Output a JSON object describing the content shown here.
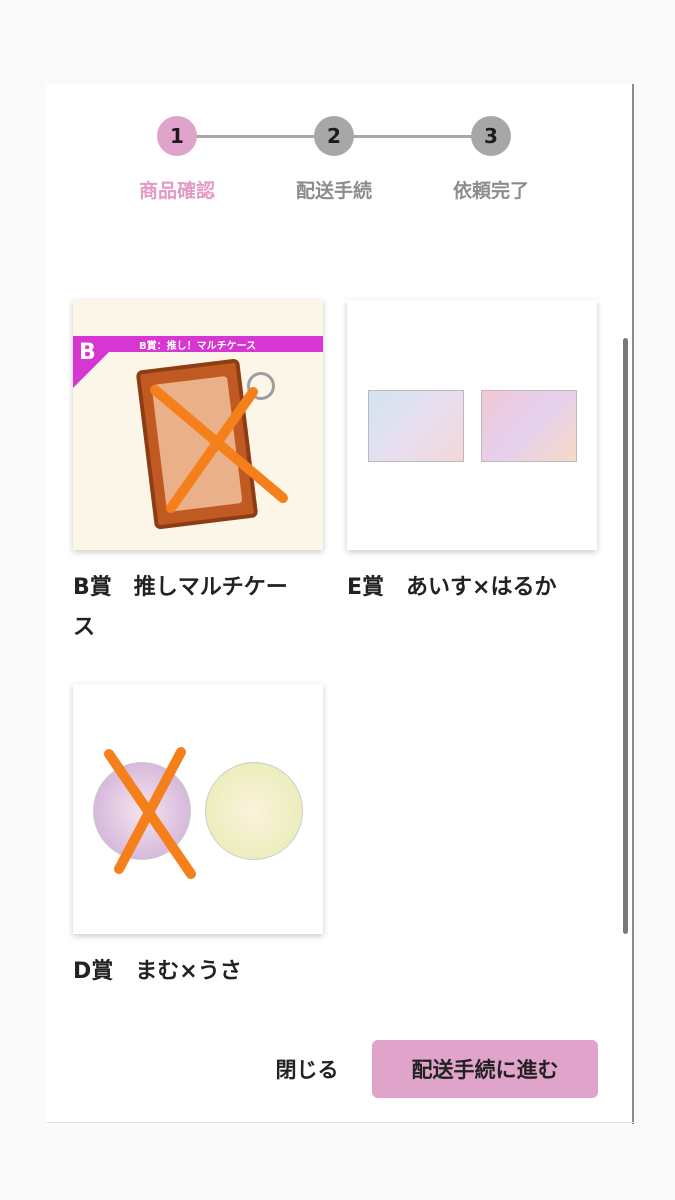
{
  "stepper": {
    "steps": [
      {
        "number": "1",
        "label": "商品確認",
        "state": "active"
      },
      {
        "number": "2",
        "label": "配送手続",
        "state": "inactive"
      },
      {
        "number": "3",
        "label": "依頼完了",
        "state": "inactive"
      }
    ]
  },
  "products": [
    {
      "title_line1": "B賞　推しマルチケー",
      "title_line2": "ス",
      "image_band_text": "B賞：推し！マルチケース",
      "image_badge": "B",
      "crossed_out": true
    },
    {
      "title_line1": "E賞　あいす×はるか",
      "crossed_out": false
    },
    {
      "title_line1": "D賞　まむ×うさ",
      "crossed_out": true
    }
  ],
  "footer": {
    "close_label": "閉じる",
    "next_label": "配送手続に進む"
  },
  "colors": {
    "accent": "#e0a3c9",
    "inactive": "#a7a7a7",
    "cross": "#f57f1b",
    "band": "#d636d1"
  }
}
